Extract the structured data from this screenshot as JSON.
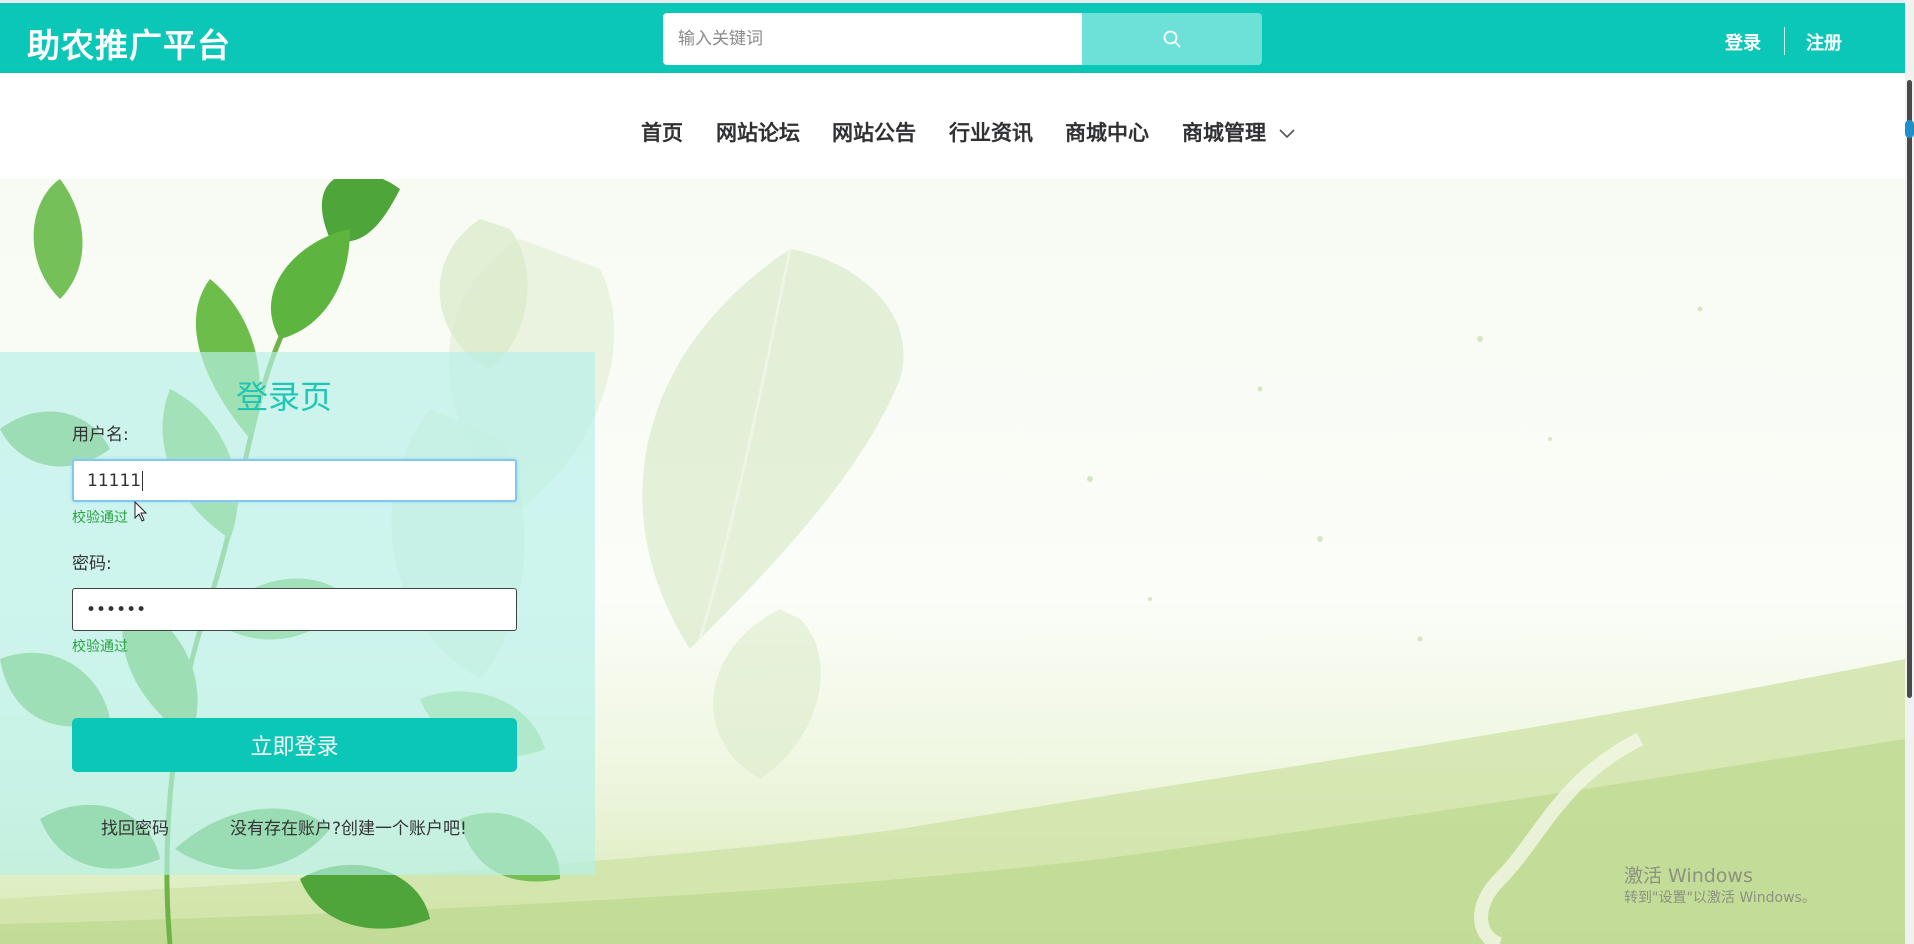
{
  "header": {
    "logo_text": "助农推广平台",
    "search_placeholder": "输入关键词",
    "login_link": "登录",
    "register_link": "注册",
    "brand_color": "#0bc7b8"
  },
  "nav": {
    "items": [
      {
        "label": "首页"
      },
      {
        "label": "网站论坛"
      },
      {
        "label": "网站公告"
      },
      {
        "label": "行业资讯"
      },
      {
        "label": "商城中心"
      },
      {
        "label": "商城管理"
      }
    ],
    "dropdown_icon": "chevron-down-icon"
  },
  "login": {
    "title": "登录页",
    "username_label": "用户名:",
    "username_value": "11111",
    "username_status": "校验通过",
    "password_label": "密码:",
    "password_value": "••••••",
    "password_status": "校验通过",
    "submit_label": "立即登录",
    "forgot_link": "找回密码",
    "register_link": "没有存在账户?创建一个账户吧!"
  },
  "watermark": {
    "title": "激活 Windows",
    "subtitle": "转到\"设置\"以激活 Windows。"
  }
}
